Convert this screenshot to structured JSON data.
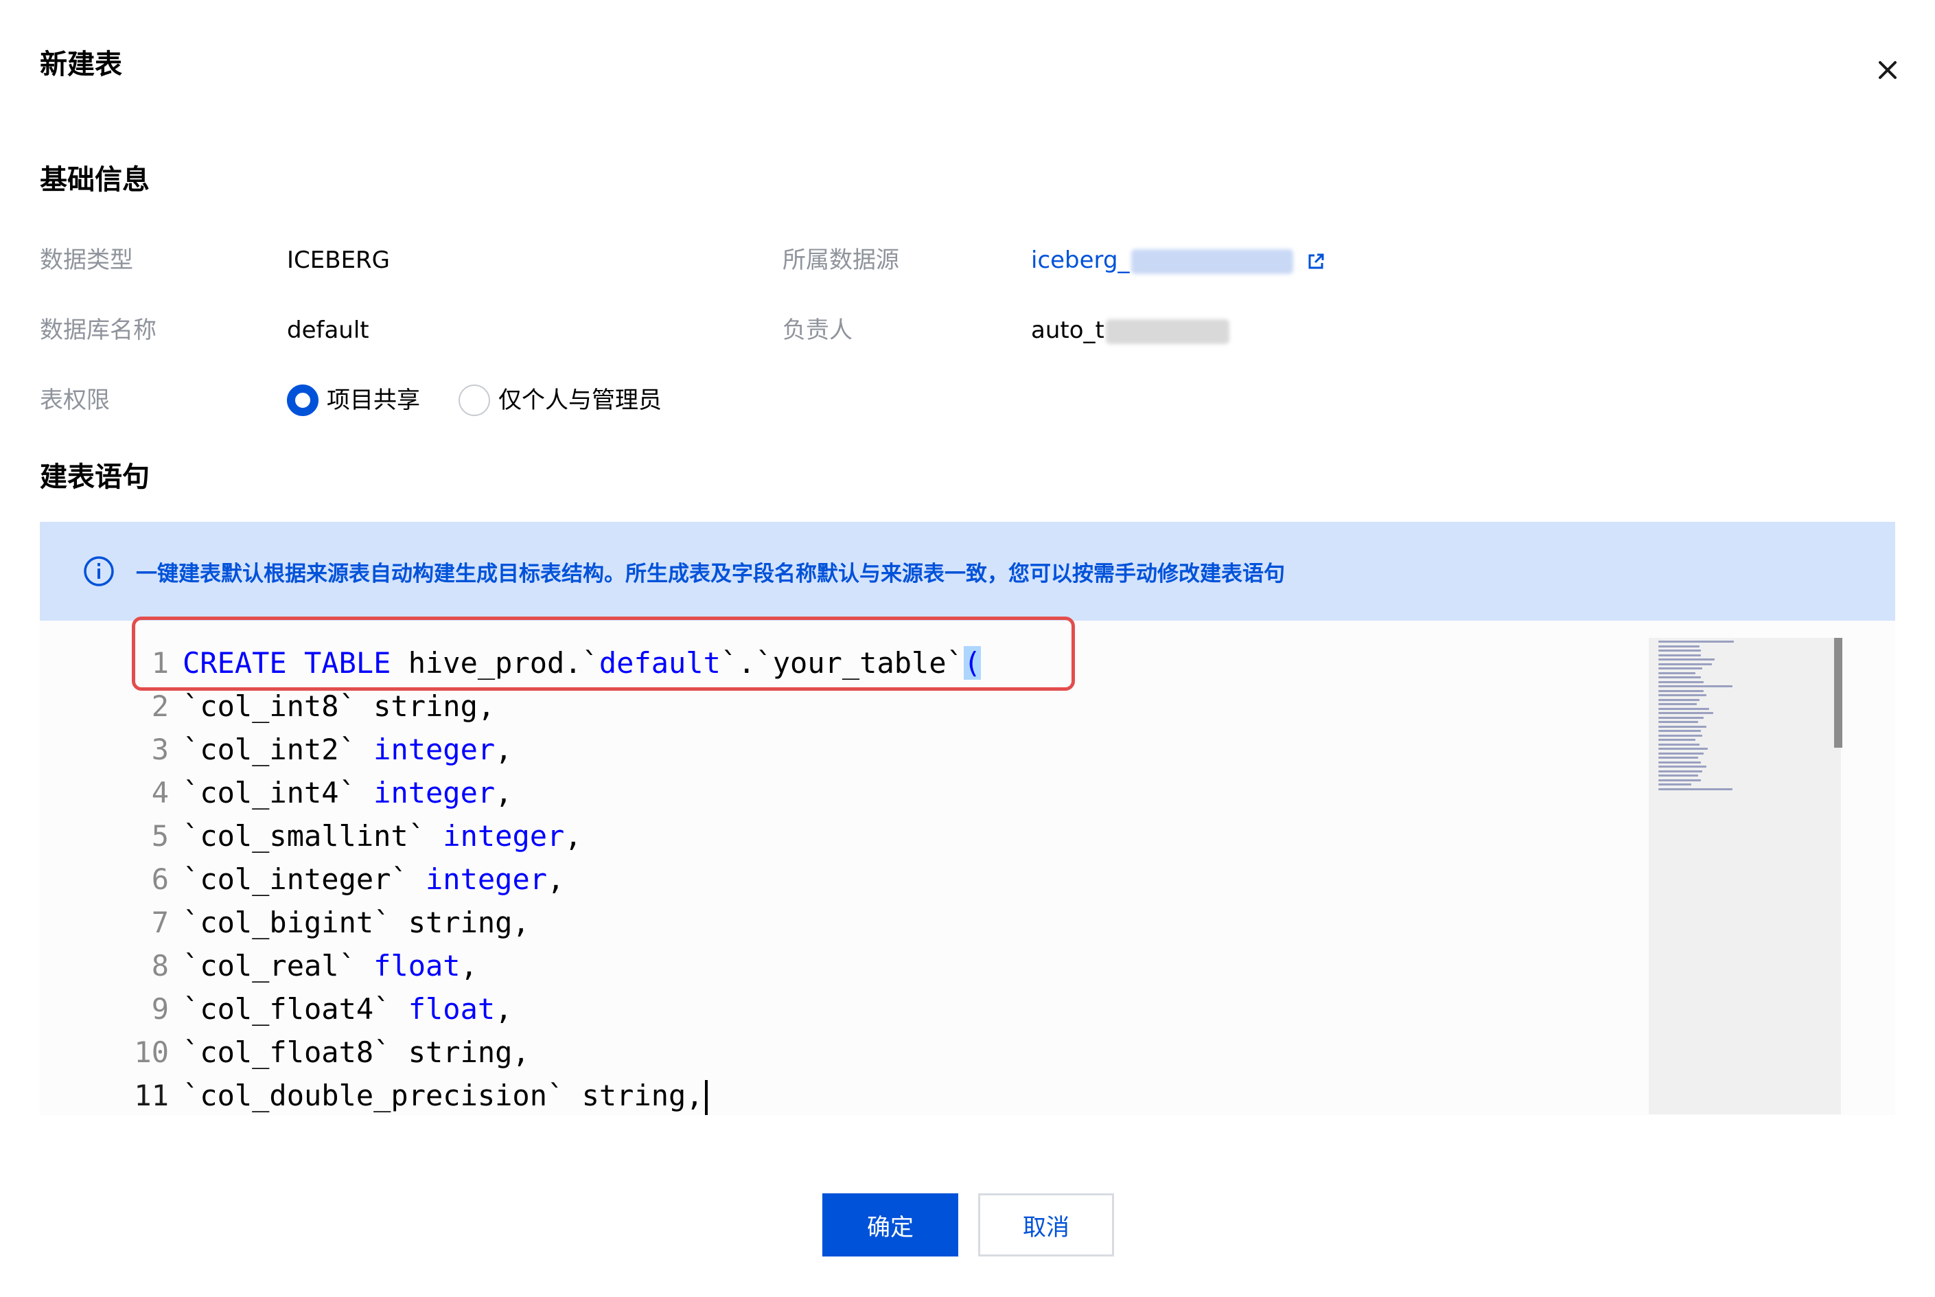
{
  "dialog": {
    "title": "新建表",
    "close_icon": "close-icon"
  },
  "basic_info": {
    "section_title": "基础信息",
    "data_type_label": "数据类型",
    "data_type_value": "ICEBERG",
    "datasource_label": "所属数据源",
    "datasource_value": "iceberg_",
    "database_label": "数据库名称",
    "database_value": "default",
    "owner_label": "负责人",
    "owner_value": "auto_t",
    "permission_label": "表权限",
    "permission_options": [
      {
        "label": "项目共享",
        "checked": true
      },
      {
        "label": "仅个人与管理员",
        "checked": false
      }
    ]
  },
  "sql_section": {
    "section_title": "建表语句",
    "info_text": "一键建表默认根据来源表自动构建生成目标表结构。所生成表及字段名称默认与来源表一致，您可以按需手动修改建表语句"
  },
  "editor": {
    "current_line": 11,
    "lines": [
      {
        "n": "1",
        "tokens": [
          {
            "t": "CREATE TABLE",
            "c": "kw"
          },
          {
            "t": " hive_prod.`",
            "c": ""
          },
          {
            "t": "default",
            "c": "str"
          },
          {
            "t": "`.`your_table`",
            "c": ""
          },
          {
            "t": "(",
            "c": "bracket-hl"
          }
        ]
      },
      {
        "n": "2",
        "tokens": [
          {
            "t": "`col_int8` string,",
            "c": ""
          }
        ]
      },
      {
        "n": "3",
        "tokens": [
          {
            "t": "`col_int2` ",
            "c": ""
          },
          {
            "t": "integer",
            "c": "kw"
          },
          {
            "t": ",",
            "c": ""
          }
        ]
      },
      {
        "n": "4",
        "tokens": [
          {
            "t": "`col_int4` ",
            "c": ""
          },
          {
            "t": "integer",
            "c": "kw"
          },
          {
            "t": ",",
            "c": ""
          }
        ]
      },
      {
        "n": "5",
        "tokens": [
          {
            "t": "`col_smallint` ",
            "c": ""
          },
          {
            "t": "integer",
            "c": "kw"
          },
          {
            "t": ",",
            "c": ""
          }
        ]
      },
      {
        "n": "6",
        "tokens": [
          {
            "t": "`col_integer` ",
            "c": ""
          },
          {
            "t": "integer",
            "c": "kw"
          },
          {
            "t": ",",
            "c": ""
          }
        ]
      },
      {
        "n": "7",
        "tokens": [
          {
            "t": "`col_bigint` string,",
            "c": ""
          }
        ]
      },
      {
        "n": "8",
        "tokens": [
          {
            "t": "`col_real` ",
            "c": ""
          },
          {
            "t": "float",
            "c": "kw"
          },
          {
            "t": ",",
            "c": ""
          }
        ]
      },
      {
        "n": "9",
        "tokens": [
          {
            "t": "`col_float4` ",
            "c": ""
          },
          {
            "t": "float",
            "c": "kw"
          },
          {
            "t": ",",
            "c": ""
          }
        ]
      },
      {
        "n": "10",
        "tokens": [
          {
            "t": "`col_float8` string,",
            "c": ""
          }
        ]
      },
      {
        "n": "11",
        "tokens": [
          {
            "t": "`col_double_precision` string,",
            "c": ""
          }
        ]
      }
    ]
  },
  "footer": {
    "confirm_label": "确定",
    "cancel_label": "取消"
  },
  "colors": {
    "primary": "#0052d9",
    "banner_bg": "#d4e3fc",
    "highlight_border": "#e34d4d",
    "keyword": "#0000ff"
  }
}
